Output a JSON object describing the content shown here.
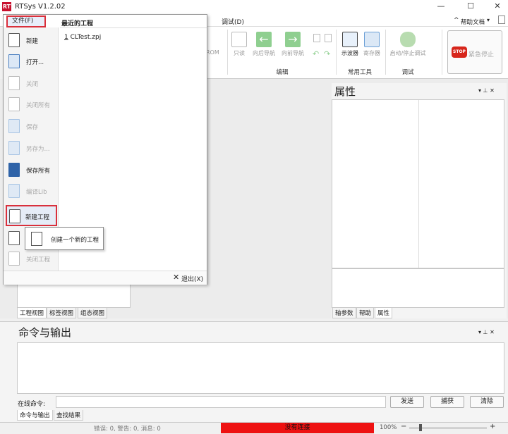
{
  "window": {
    "title": "RTSys V1.2.02",
    "logo_text": "RT",
    "help_docs": "帮助文档",
    "help_caret": "^",
    "help_dropdown": "▾"
  },
  "menubar": {
    "file": "文件(F)",
    "debug": "调试(D)"
  },
  "ribbon": {
    "partial_rom": "ROM",
    "readonly": "只读",
    "nav_back": "向后导航",
    "nav_forward": "向前导航",
    "edit_group": "编辑",
    "oscilloscope": "示波器",
    "register": "寄存器",
    "common_tools_group": "常用工具",
    "start_stop_debug": "启动/停止调试",
    "debug_group": "调试",
    "stop_icon_text": "STOP",
    "emergency_stop": "紧急停止"
  },
  "file_menu": {
    "items": [
      {
        "label": "新建",
        "enabled": true
      },
      {
        "label": "打开...",
        "enabled": true
      },
      {
        "label": "关闭",
        "enabled": false
      },
      {
        "label": "关闭所有",
        "enabled": false
      },
      {
        "label": "保存",
        "enabled": false
      },
      {
        "label": "另存为...",
        "enabled": false
      },
      {
        "label": "保存所有",
        "enabled": true
      },
      {
        "label": "编译Lib",
        "enabled": false
      },
      {
        "label": "新建工程",
        "enabled": true
      },
      {
        "label": "",
        "enabled": true
      },
      {
        "label": "关闭工程",
        "enabled": false
      }
    ],
    "recent_title": "最近的工程",
    "recent_items": [
      {
        "index": "1",
        "name": "CLTest.zpj"
      }
    ],
    "exit": "退出(X)"
  },
  "tooltip": {
    "text": "创建一个新的工程"
  },
  "project_panel": {
    "tabs": [
      "工程视图",
      "标签视图",
      "组态视图"
    ]
  },
  "properties_panel": {
    "title": "属性",
    "tabs": [
      "轴参数",
      "帮助",
      "属性"
    ]
  },
  "output_panel": {
    "title": "命令与输出",
    "command_label": "在线命令:",
    "send": "发送",
    "capture": "捕获",
    "clear": "清除",
    "tabs": [
      "命令与输出",
      "查找结果"
    ]
  },
  "statusbar": {
    "counts": "错误: 0, 警告: 0, 消息: 0",
    "connection": "没有连接",
    "zoom": "100%"
  },
  "colors": {
    "highlight_red": "#d9303c",
    "status_red": "#ee1111",
    "nav_green": "#4caf50"
  }
}
